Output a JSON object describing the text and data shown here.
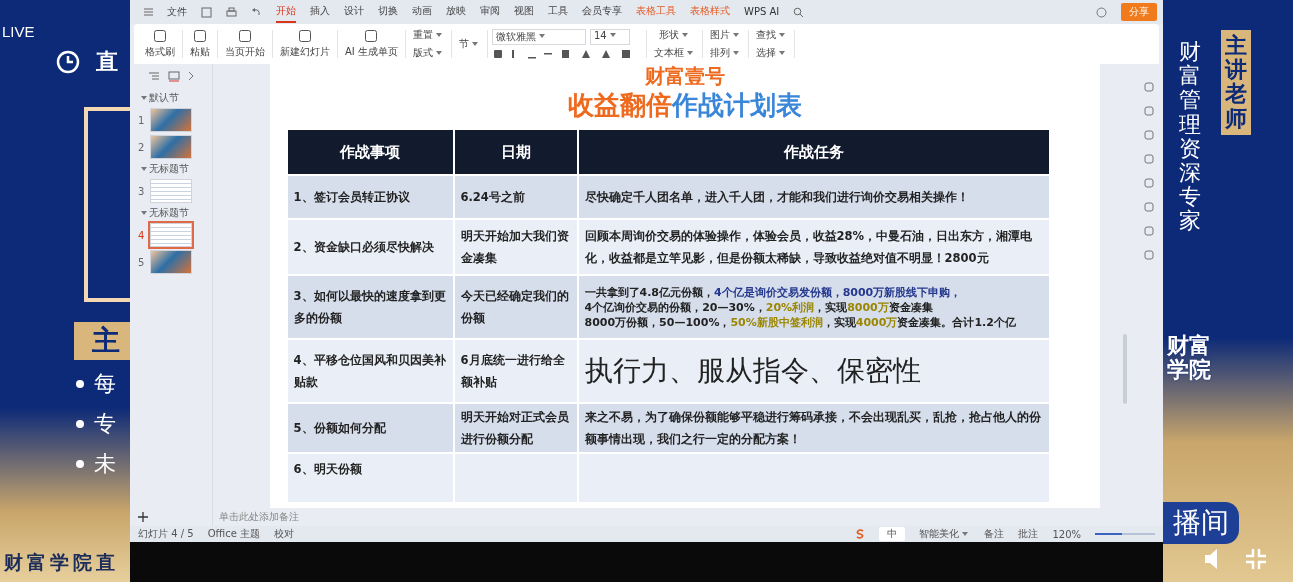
{
  "stream_left": {
    "live": "LIVE",
    "logo_text": "直",
    "host_label": "主",
    "bullets": [
      "每",
      "专",
      "未"
    ],
    "footer": "财富学院直"
  },
  "stream_right": {
    "title": "财富管理资深专家",
    "badge": "主讲老师",
    "academy": "财富学院",
    "banner": "播间"
  },
  "menu": {
    "file": "文件",
    "tabs": [
      {
        "label": "开始",
        "selected": true,
        "kind": "normal"
      },
      {
        "label": "插入",
        "selected": false,
        "kind": "normal"
      },
      {
        "label": "设计",
        "selected": false,
        "kind": "normal"
      },
      {
        "label": "切换",
        "selected": false,
        "kind": "normal"
      },
      {
        "label": "动画",
        "selected": false,
        "kind": "normal"
      },
      {
        "label": "放映",
        "selected": false,
        "kind": "normal"
      },
      {
        "label": "审阅",
        "selected": false,
        "kind": "normal"
      },
      {
        "label": "视图",
        "selected": false,
        "kind": "normal"
      },
      {
        "label": "工具",
        "selected": false,
        "kind": "normal"
      },
      {
        "label": "会员专享",
        "selected": false,
        "kind": "normal"
      },
      {
        "label": "表格工具",
        "selected": false,
        "kind": "context"
      },
      {
        "label": "表格样式",
        "selected": false,
        "kind": "context"
      },
      {
        "label": "WPS AI",
        "selected": false,
        "kind": "ai"
      }
    ],
    "share": "分享"
  },
  "ribbon": [
    {
      "kind": "big",
      "label": "格式刷"
    },
    {
      "kind": "big",
      "label": "粘贴"
    },
    {
      "kind": "big",
      "label": "当页开始"
    },
    {
      "kind": "big",
      "label": "新建幻灯片"
    },
    {
      "kind": "big",
      "label": "AI 生成单页"
    },
    {
      "kind": "pair",
      "labels": [
        "重置",
        "版式"
      ]
    },
    {
      "kind": "pair",
      "labels": [
        "节"
      ]
    },
    {
      "kind": "font",
      "font": "微软雅黑",
      "size": "14"
    },
    {
      "kind": "pair",
      "labels": [
        "形状",
        "文本框"
      ]
    },
    {
      "kind": "pair",
      "labels": [
        "图片",
        "排列"
      ]
    },
    {
      "kind": "pair",
      "labels": [
        "查找",
        "选择"
      ]
    }
  ],
  "slide_panel": {
    "sections": [
      {
        "title": "默认节",
        "slides": [
          {
            "number": "1",
            "selected": false,
            "kind": "photo"
          },
          {
            "number": "2",
            "selected": false,
            "kind": "photo"
          }
        ]
      },
      {
        "title": "无标题节",
        "slides": [
          {
            "number": "3",
            "selected": false,
            "kind": "table"
          }
        ]
      },
      {
        "title": "无标题节",
        "slides": [
          {
            "number": "4",
            "selected": true,
            "kind": "table"
          },
          {
            "number": "5",
            "selected": false,
            "kind": "photo"
          }
        ]
      }
    ]
  },
  "slide": {
    "title_lines": [
      [
        {
          "text": "财富壹号",
          "color": "#ee6a1f"
        }
      ],
      [
        {
          "text": "收益翻倍",
          "color": "#ee6a1f"
        },
        {
          "text": "作战计划表",
          "color": "#3a86d8"
        }
      ]
    ],
    "table": {
      "columns": [
        "作战事项",
        "日期",
        "作战任务"
      ],
      "rows": [
        {
          "item": "1、签订会员转正协议",
          "date": "6.24号之前",
          "kind": "text",
          "task": "尽快确定千人团名单，进入千人团，才能和我们进行询价交易相关操作！"
        },
        {
          "item": "2、资金缺口必须尽快解决",
          "date": "明天开始加大我们资金凑集",
          "kind": "text",
          "task": "回顾本周询价交易的体验操作，体验会员，收益28%，中曼石油，日出东方，湘潭电化，收益都是立竿见影，但是份额太稀缺，导致收益绝对值不明显！2800元"
        },
        {
          "item": "3、如何以最快的速度拿到更多的份额",
          "date": "今天已经确定我们的份额",
          "kind": "lines",
          "task_lines": [
            [
              {
                "text": "一共拿到了4.8亿元份额，",
                "kind": "plain"
              },
              {
                "text": "4个亿是询价交易发份额，8000万新股线下申购，",
                "kind": "blue"
              }
            ],
            [
              {
                "text": "4个亿询价交易的份额，20—30%，",
                "kind": "plain"
              },
              {
                "text": "20%利润",
                "kind": "yellow"
              },
              {
                "text": "，实现",
                "kind": "plain"
              },
              {
                "text": "8000万",
                "kind": "yellow"
              },
              {
                "text": "资金凑集",
                "kind": "plain"
              }
            ],
            [
              {
                "text": "8000万份额，50—100%，",
                "kind": "plain"
              },
              {
                "text": "50%新股中签利润",
                "kind": "yellow"
              },
              {
                "text": "，实现",
                "kind": "plain"
              },
              {
                "text": "4000万",
                "kind": "yellow"
              },
              {
                "text": "资金凑集。合计1.2个亿",
                "kind": "plain"
              }
            ]
          ]
        },
        {
          "item": "4、平移仓位国风和贝因美补贴款",
          "date": "6月底统一进行给全额补贴",
          "kind": "large",
          "task": "执行力、服从指令、保密性"
        },
        {
          "item": "5、份额如何分配",
          "date": "明天开始对正式会员进行份额分配",
          "kind": "text",
          "task": "来之不易，为了确保份额能够平稳进行筹码承接，不会出现乱买，乱抢，抢占他人的份额事情出现，我们之行一定的分配方案！"
        },
        {
          "item": "6、明天份额",
          "kind": "none"
        }
      ]
    }
  },
  "notes_placeholder": "单击此处添加备注",
  "zoom_slider": {
    "level": 0.45
  },
  "status_bar": {
    "slide_count": "幻灯片 4 / 5",
    "theme": "Office 主题",
    "proofing": "校对",
    "ime": "中",
    "beautify": "智能美化",
    "notes": "备注",
    "comments": "批注",
    "zoom": "120%"
  }
}
